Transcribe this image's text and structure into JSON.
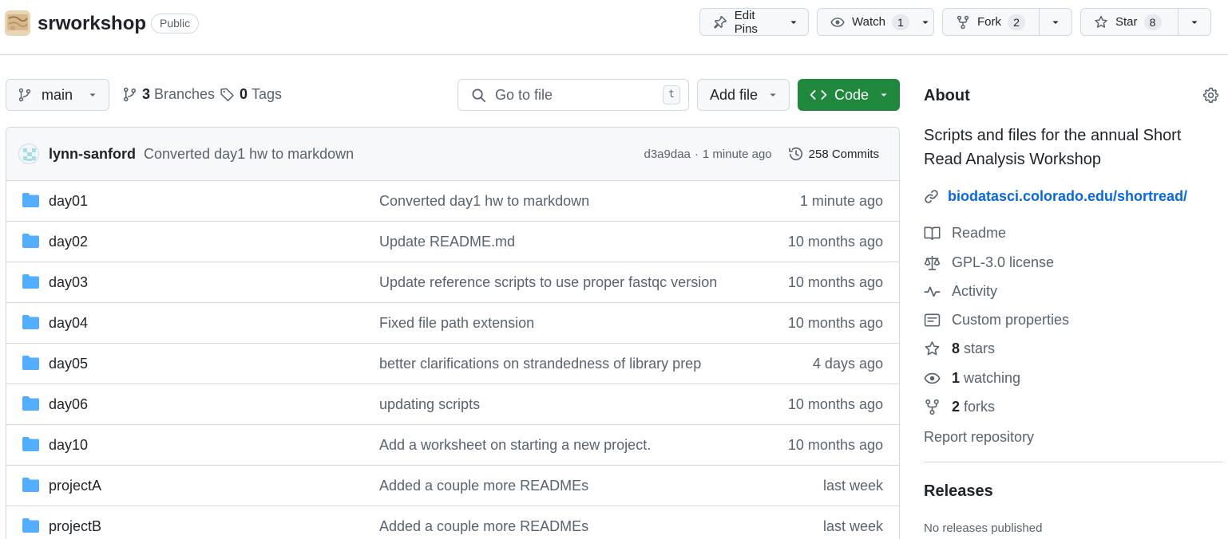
{
  "repo": {
    "name": "srworkshop",
    "visibility": "Public"
  },
  "header_actions": {
    "edit_pins": "Edit Pins",
    "watch": {
      "label": "Watch",
      "count": "1"
    },
    "fork": {
      "label": "Fork",
      "count": "2"
    },
    "star": {
      "label": "Star",
      "count": "8"
    }
  },
  "toolbar": {
    "branch": "main",
    "branches_count": "3",
    "branches_label": "Branches",
    "tags_count": "0",
    "tags_label": "Tags",
    "goto_placeholder": "Go to file",
    "goto_shortcut": "t",
    "add_file": "Add file",
    "code": "Code"
  },
  "latest_commit": {
    "author": "lynn-sanford",
    "message": "Converted day1 hw to markdown",
    "hash": "d3a9daa",
    "separator": "·",
    "time": "1 minute ago",
    "commits_count": "258 Commits"
  },
  "files": [
    {
      "name": "day01",
      "message": "Converted day1 hw to markdown",
      "date": "1 minute ago"
    },
    {
      "name": "day02",
      "message": "Update README.md",
      "date": "10 months ago"
    },
    {
      "name": "day03",
      "message": "Update reference scripts to use proper fastqc version",
      "date": "10 months ago"
    },
    {
      "name": "day04",
      "message": "Fixed file path extension",
      "date": "10 months ago"
    },
    {
      "name": "day05",
      "message": "better clarifications on strandedness of library prep",
      "date": "4 days ago"
    },
    {
      "name": "day06",
      "message": "updating scripts",
      "date": "10 months ago"
    },
    {
      "name": "day10",
      "message": "Add a worksheet on starting a new project.",
      "date": "10 months ago"
    },
    {
      "name": "projectA",
      "message": "Added a couple more READMEs",
      "date": "last week"
    },
    {
      "name": "projectB",
      "message": "Added a couple more READMEs",
      "date": "last week"
    }
  ],
  "about": {
    "title": "About",
    "description": "Scripts and files for the annual Short Read Analysis Workshop",
    "homepage": "biodatasci.colorado.edu/shortread/",
    "readme": "Readme",
    "license": "GPL-3.0 license",
    "activity": "Activity",
    "custom_properties": "Custom properties",
    "stars_count": "8",
    "stars_label": "stars",
    "watching_count": "1",
    "watching_label": "watching",
    "forks_count": "2",
    "forks_label": "forks",
    "report": "Report repository"
  },
  "releases": {
    "title": "Releases",
    "empty": "No releases published"
  },
  "colors": {
    "accent_link": "#0969da",
    "code_button": "#1f883d",
    "folder": "#54aeff",
    "muted_text": "#59636e",
    "border": "#d1d9e0"
  },
  "icons": [
    "pin-icon",
    "eye-icon",
    "fork-icon",
    "star-icon",
    "branch-icon",
    "tag-icon",
    "search-icon",
    "code-icon",
    "history-icon",
    "folder-icon",
    "gear-icon",
    "link-icon",
    "book-icon",
    "scale-icon",
    "pulse-icon",
    "note-icon",
    "chevron-down-icon"
  ]
}
